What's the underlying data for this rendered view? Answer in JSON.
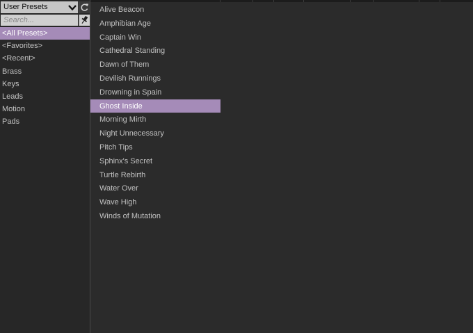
{
  "browser": {
    "source_selector": {
      "value": "User Presets"
    },
    "search": {
      "placeholder": "Search...",
      "value": ""
    },
    "icons": {
      "dropdown": "chevron-down-icon",
      "refresh": "refresh-icon",
      "pin": "pin-icon"
    },
    "accent_color": "#a58bb8",
    "categories": [
      {
        "label": "<All Presets>",
        "selected": true
      },
      {
        "label": "<Favorites>",
        "selected": false
      },
      {
        "label": "<Recent>",
        "selected": false
      },
      {
        "label": "Brass",
        "selected": false
      },
      {
        "label": "Keys",
        "selected": false
      },
      {
        "label": "Leads",
        "selected": false
      },
      {
        "label": "Motion",
        "selected": false
      },
      {
        "label": "Pads",
        "selected": false
      }
    ],
    "presets": [
      {
        "label": "Alive Beacon",
        "selected": false
      },
      {
        "label": "Amphibian Age",
        "selected": false
      },
      {
        "label": "Captain Win",
        "selected": false
      },
      {
        "label": "Cathedral Standing",
        "selected": false
      },
      {
        "label": "Dawn of Them",
        "selected": false
      },
      {
        "label": "Devilish Runnings",
        "selected": false
      },
      {
        "label": "Drowning in Spain",
        "selected": false
      },
      {
        "label": "Ghost Inside",
        "selected": true
      },
      {
        "label": "Morning Mirth",
        "selected": false
      },
      {
        "label": "Night Unnecessary",
        "selected": false
      },
      {
        "label": "Pitch Tips",
        "selected": false
      },
      {
        "label": "Sphinx's Secret",
        "selected": false
      },
      {
        "label": "Turtle Rebirth",
        "selected": false
      },
      {
        "label": "Water Over",
        "selected": false
      },
      {
        "label": "Wave High",
        "selected": false
      },
      {
        "label": "Winds of Mutation",
        "selected": false
      }
    ]
  }
}
